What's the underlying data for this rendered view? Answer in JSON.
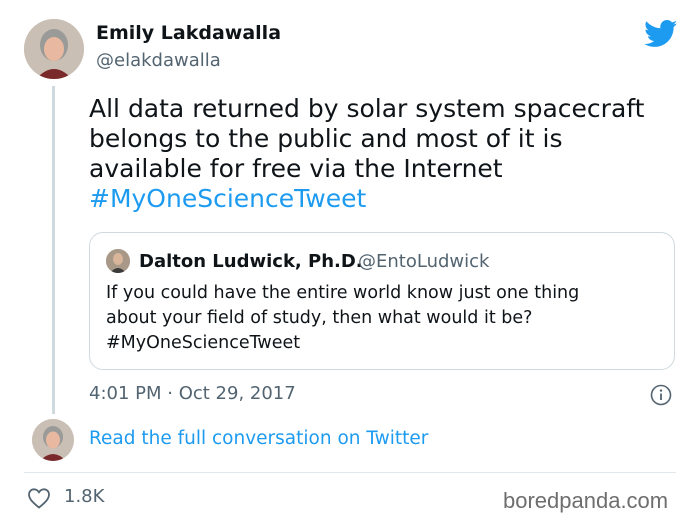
{
  "author": {
    "name": "Emily Lakdawalla",
    "handle": "@elakdawalla"
  },
  "tweet": {
    "text": "All data returned by solar system spacecraft\nbelongs to the public and most of it is\navailable for free via the Internet",
    "hashtag": "#MyOneScienceTweet",
    "timestamp": "4:01 PM · Oct 29, 2017"
  },
  "quoted_tweet": {
    "name": "Dalton Ludwick, Ph.D.",
    "handle": "@EntoLudwick",
    "text": "If you could have the entire world know just one thing\nabout your field of study, then what would it be?\n#MyOneScienceTweet"
  },
  "conversation_link": "Read the full conversation on Twitter",
  "likes": "1.8K",
  "watermark": "boredpanda.com",
  "icons": {
    "logo": "twitter-bird-icon",
    "info": "info-icon",
    "like": "heart-icon"
  },
  "colors": {
    "accent": "#1d9bf0",
    "text": "#0f1419",
    "secondary": "#536471",
    "border": "#cfd9de"
  }
}
